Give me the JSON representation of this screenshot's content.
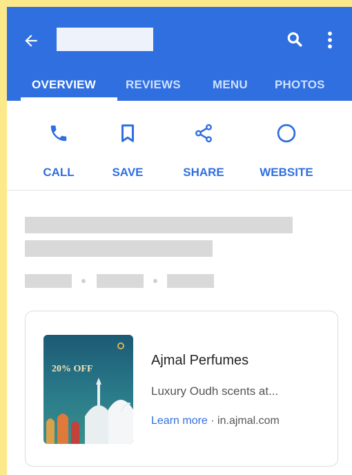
{
  "header": {
    "back_icon": "back-arrow-icon",
    "search_icon": "search-icon",
    "more_icon": "more-vert-icon",
    "title": "",
    "background_color": "#2f6fe0"
  },
  "tabs": [
    {
      "label": "OVERVIEW",
      "active": true
    },
    {
      "label": "REVIEWS",
      "active": false
    },
    {
      "label": "MENU",
      "active": false
    },
    {
      "label": "PHOTOS",
      "active": false
    }
  ],
  "actions": [
    {
      "label": "CALL",
      "icon": "phone-icon"
    },
    {
      "label": "SAVE",
      "icon": "bookmark-icon"
    },
    {
      "label": "SHARE",
      "icon": "share-icon"
    },
    {
      "label": "WEBSITE",
      "icon": "globe-icon"
    }
  ],
  "ad": {
    "title": "Ajmal Perfumes",
    "description": "Luxury Oudh scents at...",
    "link_label": "Learn more",
    "separator": " · ",
    "domain": "in.ajmal.com",
    "image_text": "20% OFF"
  },
  "colors": {
    "accent": "#2f6fe0",
    "page_background": "#fbe98a"
  }
}
